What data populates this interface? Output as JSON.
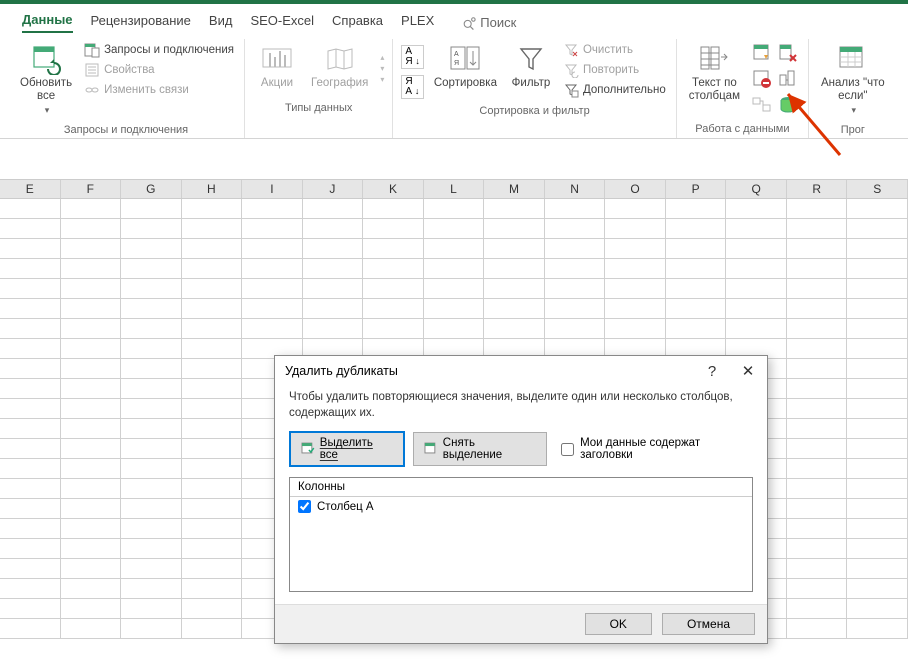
{
  "tabs": [
    "Данные",
    "Рецензирование",
    "Вид",
    "SEO-Excel",
    "Справка",
    "PLEX"
  ],
  "search_placeholder": "Поиск",
  "ribbon": {
    "group1": {
      "refresh": "Обновить\nвсе",
      "queries": "Запросы и подключения",
      "properties": "Свойства",
      "edit_links": "Изменить связи",
      "label": "Запросы и подключения"
    },
    "group2": {
      "stocks": "Акции",
      "geo": "География",
      "label": "Типы данных"
    },
    "group3": {
      "sort": "Сортировка",
      "filter": "Фильтр",
      "clear": "Очистить",
      "reapply": "Повторить",
      "advanced": "Дополнительно",
      "label": "Сортировка и фильтр"
    },
    "group4": {
      "text_to_cols": "Текст по\nстолбцам",
      "label": "Работа с данными"
    },
    "group5": {
      "whatif": "Анализ \"что\nесли\"",
      "label": "Прог"
    }
  },
  "columns": [
    "E",
    "F",
    "G",
    "H",
    "I",
    "J",
    "K",
    "L",
    "M",
    "N",
    "O",
    "P",
    "Q",
    "R",
    "S"
  ],
  "dialog": {
    "title": "Удалить дубликаты",
    "help": "?",
    "close": "✕",
    "text": "Чтобы удалить повторяющиеся значения, выделите один или несколько столбцов, содержащих их.",
    "select_all": "Выделить все",
    "unselect_all": "Снять выделение",
    "has_headers": "Мои данные содержат заголовки",
    "columns_label": "Колонны",
    "column_item": "Столбец A",
    "ok": "OK",
    "cancel": "Отмена"
  }
}
